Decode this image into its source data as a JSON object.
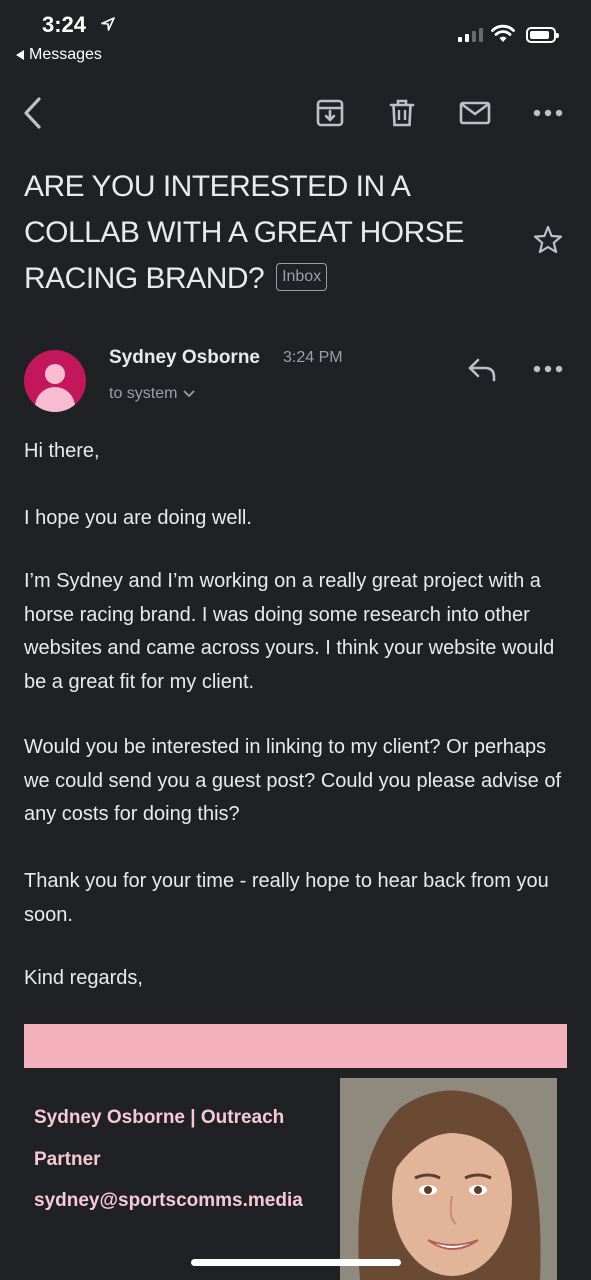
{
  "status_bar": {
    "time": "3:24",
    "back_app_label": "Messages"
  },
  "toolbar": {
    "back_icon": "chevron-left-icon",
    "archive_icon": "archive-icon",
    "delete_icon": "trash-icon",
    "mark_unread_icon": "mail-icon",
    "more_icon": "more-horizontal-icon"
  },
  "email": {
    "subject": "ARE YOU INTERESTED IN A COLLAB WITH A GREAT HORSE RACING BRAND?",
    "label": "Inbox",
    "sender": {
      "name": "Sydney Osborne",
      "time": "3:24 PM",
      "to": "to system"
    },
    "body": [
      "Hi there,",
      "I hope you are doing well.",
      "I’m Sydney and I’m working on a really great project with a horse racing brand. I was doing some research into other websites and came across yours. I think your website would be a great fit for my client.",
      "Would you be interested in linking to my client? Or perhaps we could send you a guest post?  Could you please advise of any costs for doing this?",
      "Thank you for your time - really hope to hear back from you soon.",
      "Kind regards,"
    ],
    "signature": {
      "line1": "Sydney Osborne | Outreach",
      "line2": "Partner",
      "email": "sydney@sportscomms.media"
    }
  },
  "colors": {
    "background": "#202124",
    "avatar": "#c2185b",
    "signature_bar": "#f4b1bb",
    "signature_text": "#f8c8d3"
  }
}
